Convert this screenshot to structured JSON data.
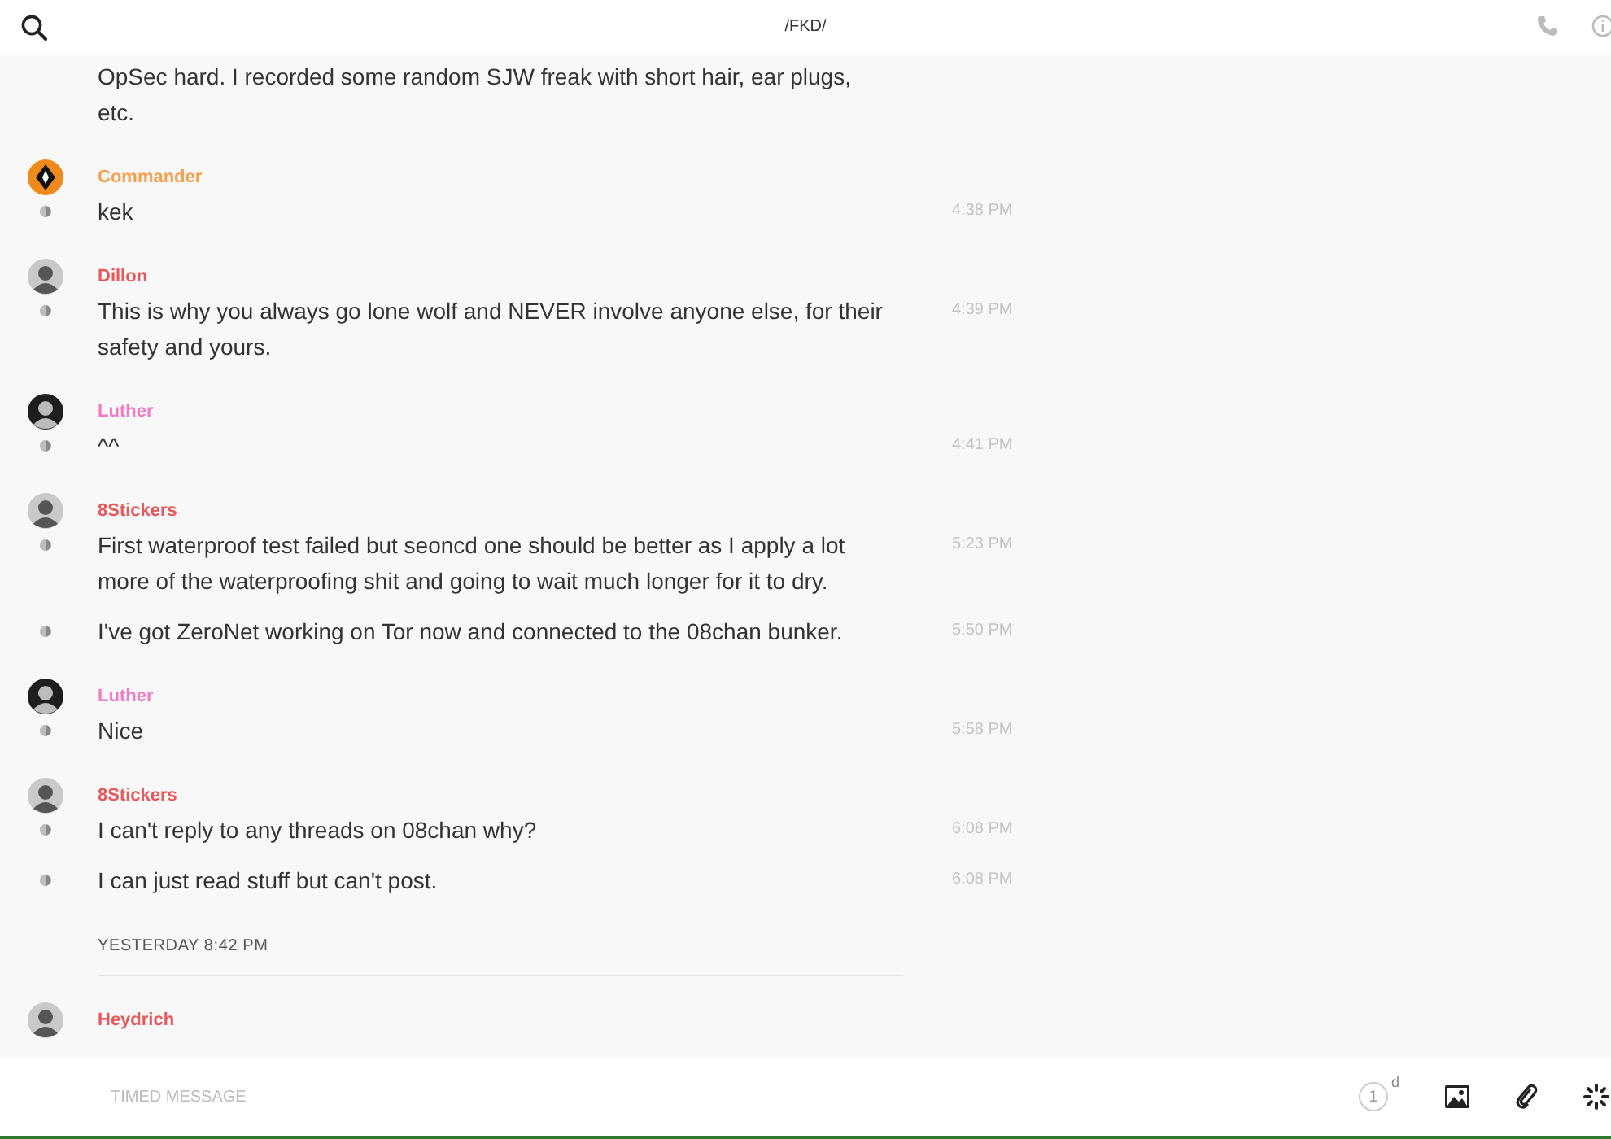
{
  "header": {
    "title": "/FKD/"
  },
  "groups": [
    {
      "messages": [
        {
          "text": "OpSec hard. I recorded some random SJW freak with short hair, ear plugs, etc.",
          "receipt": false
        }
      ]
    },
    {
      "sender": "Commander",
      "color": "#f5a04a",
      "kind": "emblem",
      "messages": [
        {
          "text": "kek",
          "time": "4:38 PM",
          "receipt": true
        }
      ]
    },
    {
      "sender": "Dillon",
      "color": "#e8575a",
      "kind": "photo",
      "messages": [
        {
          "text": "This is why you always go lone wolf and NEVER involve anyone else, for their safety and yours.",
          "time": "4:39 PM",
          "receipt": true
        }
      ]
    },
    {
      "sender": "Luther",
      "color": "#f07ac4",
      "kind": "dark-photo",
      "messages": [
        {
          "text": "^^",
          "time": "4:41 PM",
          "receipt": true
        }
      ]
    },
    {
      "sender": "8Stickers",
      "color": "#e8575a",
      "kind": "photo",
      "messages": [
        {
          "text": "First waterproof test failed but seoncd one should be better as I apply a lot more of the waterproofing shit and going to wait much longer for it to dry.",
          "time": "5:23 PM",
          "receipt": true
        },
        {
          "text": "I've got ZeroNet working on Tor now and connected to the 08chan bunker.",
          "time": "5:50 PM",
          "receipt": true
        }
      ]
    },
    {
      "sender": "Luther",
      "color": "#f07ac4",
      "kind": "dark-photo",
      "messages": [
        {
          "text": "Nice",
          "time": "5:58 PM",
          "receipt": true
        }
      ]
    },
    {
      "sender": "8Stickers",
      "color": "#e8575a",
      "kind": "photo",
      "messages": [
        {
          "text": "I can't reply to any threads on 08chan why?",
          "time": "6:08 PM",
          "receipt": true
        },
        {
          "text": "I can just read stuff but can't post.",
          "time": "6:08 PM",
          "receipt": true
        }
      ]
    },
    {
      "divider": "YESTERDAY 8:42 PM",
      "sender": "Heydrich",
      "color": "#e8575a",
      "kind": "photo"
    }
  ],
  "composer": {
    "placeholder": "TIMED MESSAGE",
    "timer": {
      "value": "1",
      "unit": "d"
    }
  }
}
